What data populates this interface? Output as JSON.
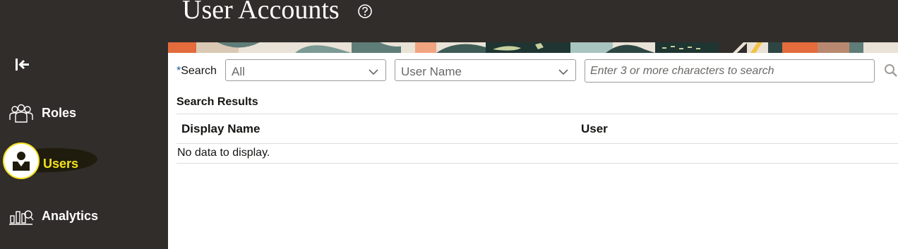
{
  "header": {
    "title": "User Accounts"
  },
  "sidebar": {
    "items": [
      {
        "label": "Roles"
      },
      {
        "label": "Users"
      },
      {
        "label": "Analytics"
      }
    ]
  },
  "search": {
    "label": "Search",
    "required_marker": "*",
    "scope_value": "All",
    "field_value": "User Name",
    "placeholder": "Enter 3 or more characters to search"
  },
  "results": {
    "title": "Search Results",
    "columns": [
      "Display Name",
      "User"
    ],
    "rows": [],
    "empty_message": "No data to display."
  },
  "colors": {
    "sidebar_bg": "#312d2a",
    "active_accent": "#f5e21d",
    "text": "#161513"
  }
}
